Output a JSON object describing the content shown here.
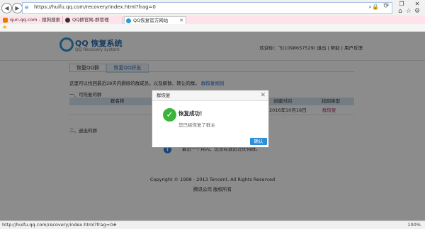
{
  "browser": {
    "url": "https://huifu.qq.com/recovery/index.html?frag=0",
    "tabs": [
      {
        "label": "qun.qq.com - 搜狗搜索"
      },
      {
        "label": "QQ群官网-群管理"
      },
      {
        "label": "QQ恢复官方网站"
      }
    ],
    "status_url": "http://huifu.qq.com/recovery/index.html?frag=0#",
    "zoom": "100%"
  },
  "site": {
    "logo_title": "QQ 恢复系统",
    "logo_sub": "QQ Recovery system",
    "top_links": "欢迎你：飞(1098657529) 退出 | 帮助 | 用户反馈"
  },
  "main": {
    "tabs": [
      {
        "label": "恢复QQ群"
      },
      {
        "label": "恢复QQ好友"
      }
    ],
    "hint": "这里可以找回最近28天内删除的群成员，以及解散、转让的群。",
    "hint_link": "群恢复规则",
    "section1": "一、可恢复的群",
    "columns": [
      "群名称",
      "创建时间",
      "找回类型"
    ],
    "rows": [
      {
        "name": "",
        "created": "2016年10月18日",
        "type": "群恢复"
      }
    ],
    "section2": "二、退出的群",
    "info_text": "最近一个月内，您没有退出过任何群。",
    "copyright": "Copyright © 1998 - 2013 Tencent. All Rights Reserved",
    "company": "腾讯公司 版权所有"
  },
  "modal": {
    "title": "群恢复",
    "success_title": "恢复成功！",
    "success_msg": "您已经恢复了群主",
    "confirm": "确认"
  },
  "colors": {
    "accent": "#2c8fd8",
    "success": "#3cb43c",
    "tab_bg": "#ffe3ea"
  }
}
